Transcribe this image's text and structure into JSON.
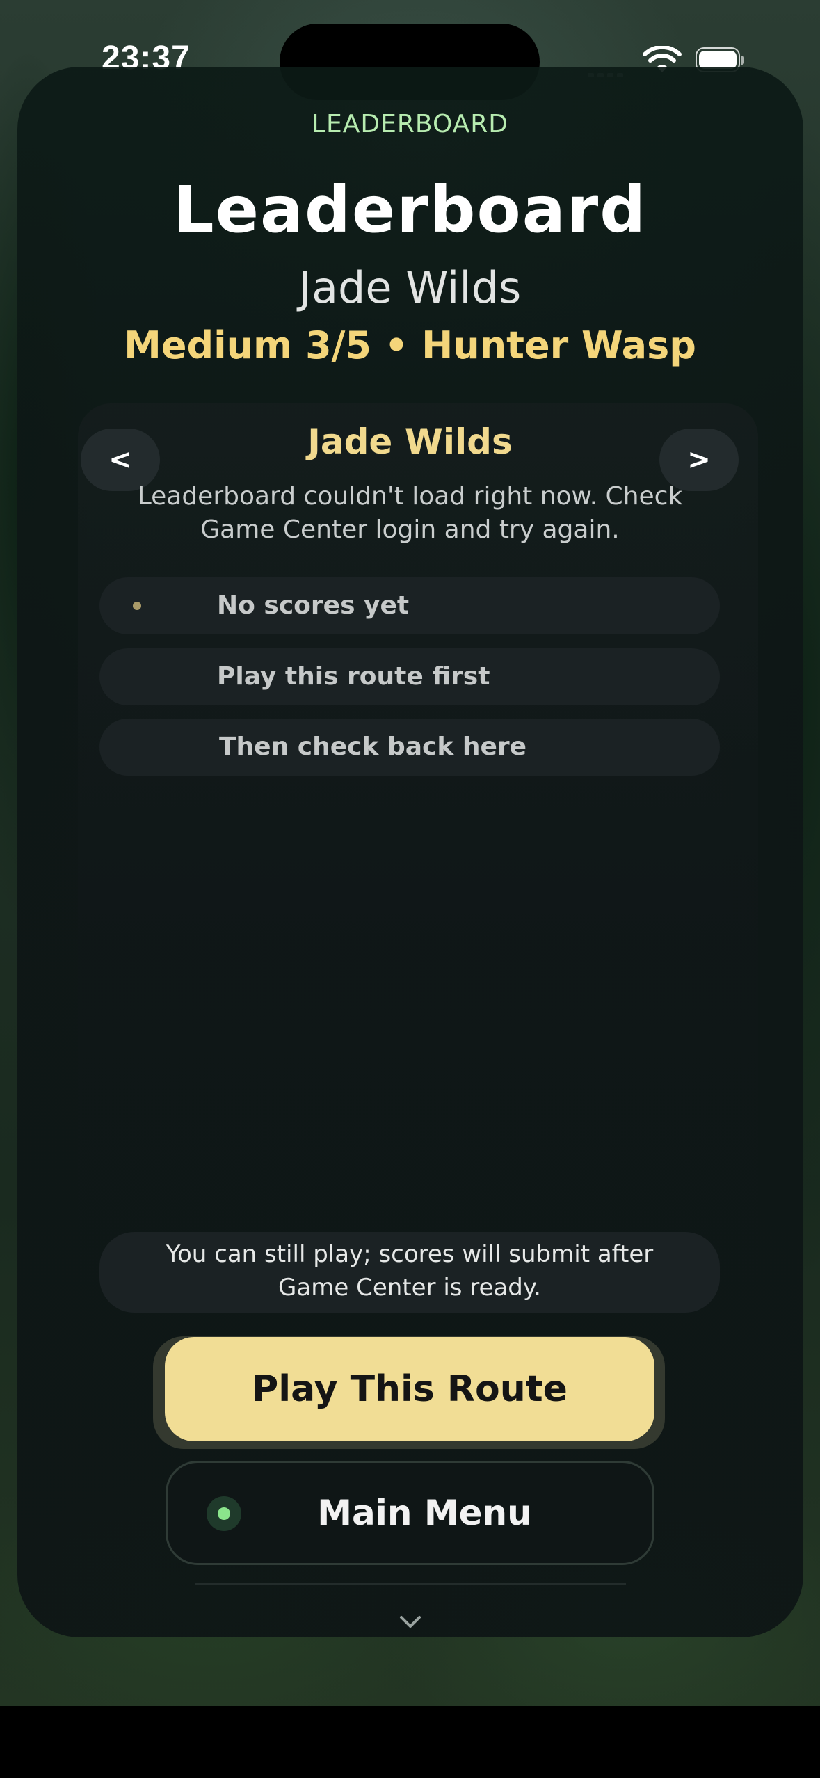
{
  "status_bar": {
    "time": "23:37"
  },
  "header": {
    "eyebrow": "LEADERBOARD",
    "title": "Leaderboard",
    "subtitle": "Jade Wilds",
    "difficulty": "Medium 3/5 • Hunter Wasp"
  },
  "route_selector": {
    "prev_label": "<",
    "next_label": ">",
    "route_name": "Jade Wilds"
  },
  "error_message": "Leaderboard couldn't load right now. Check Game Center login and try again.",
  "score_rows": [
    {
      "text": "No scores yet"
    },
    {
      "text": "Play this route first"
    },
    {
      "text": "Then check back here"
    }
  ],
  "notice": "You can still play; scores will submit after Game Center is ready.",
  "actions": {
    "play_label": "Play This Route",
    "menu_label": "Main Menu"
  },
  "colors": {
    "accent_gold": "#f1dd95",
    "difficulty_gold": "#f4d57a",
    "eyebrow_green": "#b7ecb0",
    "status_dot_green": "#8be58c"
  }
}
